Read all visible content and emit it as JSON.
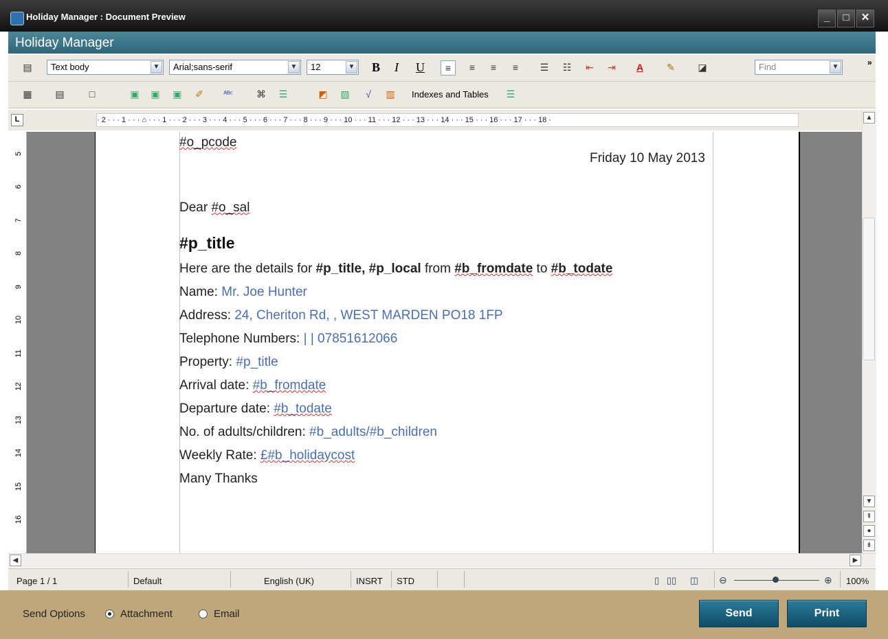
{
  "window": {
    "title": "Holiday Manager : Document Preview",
    "minimize": "_",
    "maximize": "□",
    "close": "✕"
  },
  "app": {
    "name": "Holiday Manager"
  },
  "toolbar1": {
    "style": "Text body",
    "font": "Arial;sans-serif",
    "size": "12",
    "bold": "B",
    "italic": "I",
    "underline": "U",
    "find_placeholder": "Find",
    "more": "»"
  },
  "toolbar2": {
    "indexes_label": "Indexes and Tables"
  },
  "ruler": {
    "corner": "L",
    "marks": "· 2 · · · 1 · · · ⌂ · · · 1 · · · 2 · · · 3 · · · 4 · · · 5 · · · 6 · · · 7 · · · 8 · · · 9 · · · 10 · · · 11 · · · 12 · · · 13 · · · 14 · · · 15 · · · 16 · · · 17 · · · 18 ·",
    "vertical": [
      "5",
      "6",
      "7",
      "8",
      "9",
      "10",
      "11",
      "12",
      "13",
      "14",
      "15",
      "16"
    ]
  },
  "document": {
    "pcode": "#o_pcode",
    "date": "Friday 10 May 2013",
    "salutation_prefix": "Dear ",
    "salutation_var": "#o_sal",
    "heading": "#p_title",
    "intro": {
      "a": "Here are the details for ",
      "b": "#p_title, #p_local",
      "c": " from ",
      "d": "#b_fromdate",
      "e": " to ",
      "f": "#b_todate"
    },
    "fields": [
      {
        "label": "Name: ",
        "value": "Mr. Joe Hunter"
      },
      {
        "label": "Address: ",
        "value": "24, Cheriton Rd, , WEST MARDEN PO18 1FP"
      },
      {
        "label": "Telephone Numbers: ",
        "value": " |  | 07851612066"
      },
      {
        "label": "Property: ",
        "value": "#p_title"
      },
      {
        "label": "Arrival date: ",
        "value": "#b_fromdate"
      },
      {
        "label": "Departure date: ",
        "value": "#b_todate"
      },
      {
        "label": "No. of adults/children: ",
        "value": "#b_adults/#b_children"
      },
      {
        "label": "Weekly Rate: ",
        "value": "£#b_holidaycost"
      }
    ],
    "closing": "Many Thanks"
  },
  "statusbar": {
    "page": "Page 1 / 1",
    "style": "Default",
    "language": "English (UK)",
    "insert": "INSRT",
    "selection": "STD",
    "zoom": "100%"
  },
  "bottom": {
    "send_options": "Send Options",
    "attachment": "Attachment",
    "email": "Email",
    "selected": "Attachment",
    "send": "Send",
    "print": "Print"
  }
}
